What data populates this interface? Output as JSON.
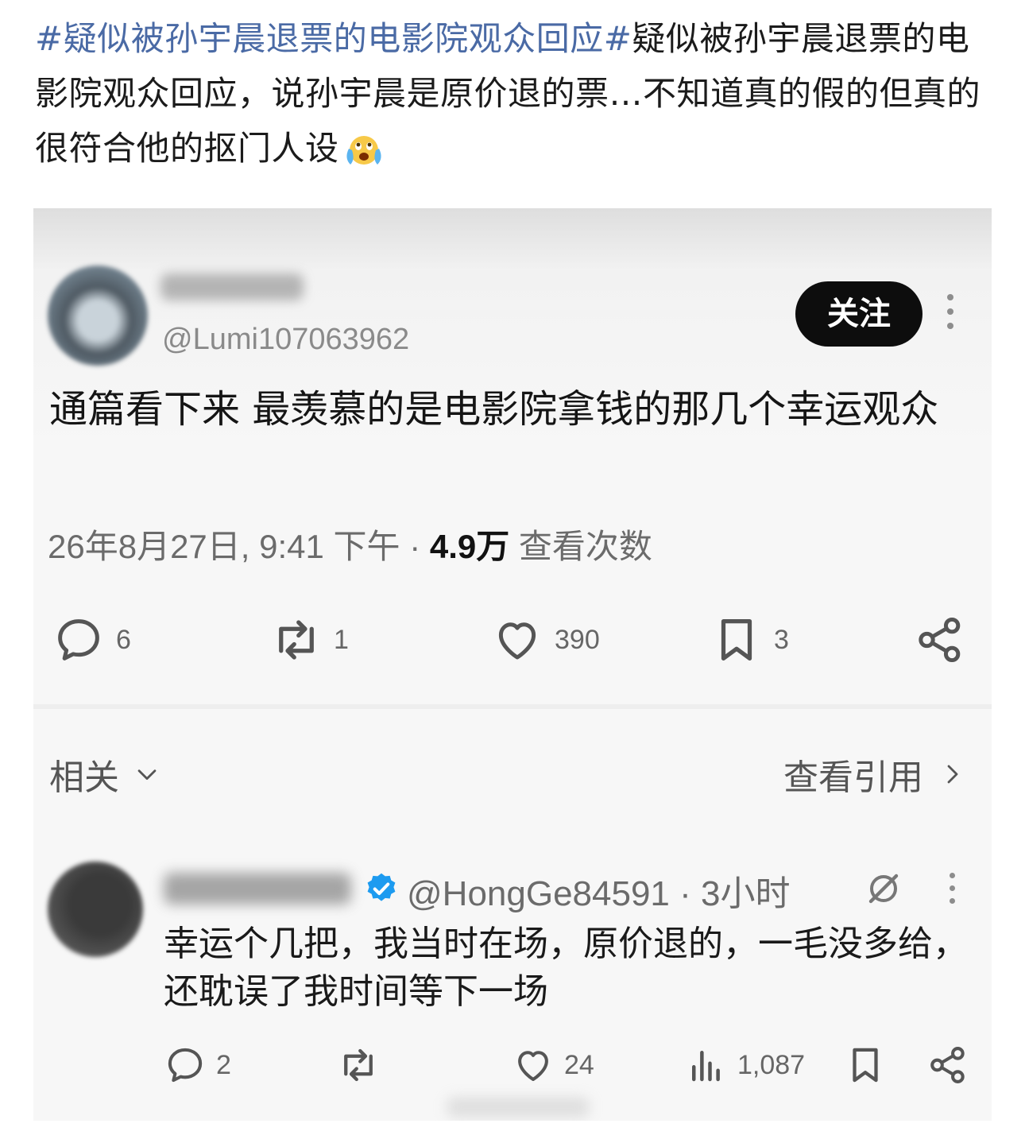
{
  "post": {
    "hashtag": "#疑似被孙宇晨退票的电影院观众回应#",
    "text": "疑似被孙宇晨退票的电影院观众回应，说孙宇晨是原价退的票…不知道真的假的但真的很符合他的抠门人设",
    "emoji": "loudly-crying-face"
  },
  "screenshot": {
    "tweet": {
      "handle": "@Lumi107063962",
      "follow_label": "关注",
      "body": "通篇看下来 最羡慕的是电影院拿钱的那几个幸运观众",
      "timestamp": "26年8月27日, 9:41 下午",
      "separator": " · ",
      "views_count": "4.9万",
      "views_label": " 查看次数",
      "actions": {
        "replies": "6",
        "reposts": "1",
        "likes": "390",
        "bookmarks": "3"
      }
    },
    "related_label": "相关",
    "view_quotes_label": "查看引用",
    "reply": {
      "handle_time": "@HongGe84591 · 3小时",
      "body": "幸运个几把，我当时在场，原价退的，一毛没多给，还耽误了我时间等下一场",
      "actions": {
        "replies": "2",
        "likes": "24",
        "views": "1,087"
      }
    },
    "colors": {
      "hashtag": "#4a6aa5",
      "verified": "#1d9bf0",
      "follow_bg": "#0d0d0d"
    }
  }
}
